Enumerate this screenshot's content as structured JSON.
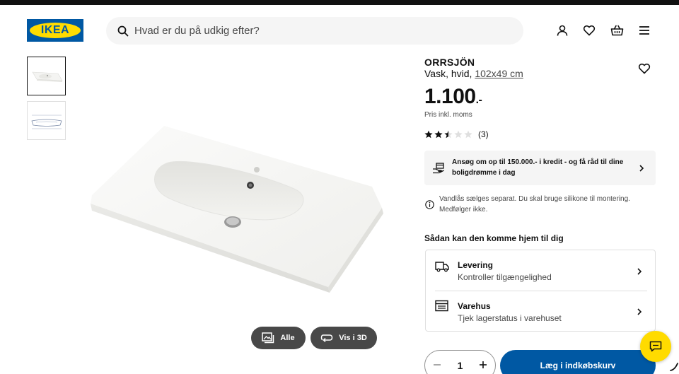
{
  "header": {
    "logo_text": "IKEA",
    "search_placeholder": "Hvad er du på udkig efter?"
  },
  "nav_icons": [
    "user-icon",
    "heart-icon",
    "basket-icon",
    "menu-icon"
  ],
  "gallery": {
    "buttons": {
      "all_label": "Alle",
      "view3d_label": "Vis i 3D"
    }
  },
  "product": {
    "name": "ORRSJÖN",
    "description": "Vask, hvid, ",
    "dimensions": "102x49 cm",
    "price": "1.100",
    "price_suffix": ".-",
    "price_note": "Pris inkl. moms",
    "rating": 2.5,
    "rating_max": 5,
    "rating_count": "(3)"
  },
  "credit_banner": {
    "text": "Ansøg om op til 150.000.- i kredit - og få råd til dine boligdrømme i dag"
  },
  "info_note": "Vandlås sælges separat. Du skal bruge silikone til montering. Medfølger ikke.",
  "delivery": {
    "title": "Sådan kan den komme hjem til dig",
    "options": [
      {
        "label": "Levering",
        "sub": "Kontroller tilgængelighed"
      },
      {
        "label": "Varehus",
        "sub": "Tjek lagerstatus i varehuset"
      }
    ]
  },
  "purchase": {
    "quantity": "1",
    "add_label": "Læg i indkøbskurv"
  },
  "colors": {
    "ikea_blue": "#0058a3",
    "ikea_yellow": "#ffdb00",
    "gray_bg": "#f5f5f5",
    "dark_btn": "#484848"
  }
}
